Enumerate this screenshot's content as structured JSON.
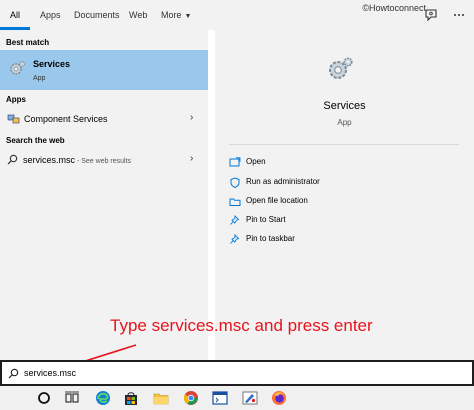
{
  "tabs": [
    {
      "label": "All",
      "active": true
    },
    {
      "label": "Apps"
    },
    {
      "label": "Documents"
    },
    {
      "label": "Web"
    },
    {
      "label": "More"
    }
  ],
  "watermark": "©Howtoconnect",
  "sections": {
    "best_match": "Best match",
    "apps": "Apps",
    "search_web": "Search the web"
  },
  "best_match_item": {
    "title": "Services",
    "subtitle": "App"
  },
  "apps_item": {
    "title": "Component Services"
  },
  "web_item": {
    "title": "services.msc",
    "suffix": " - See web results"
  },
  "details": {
    "app_name": "Services",
    "app_type": "App",
    "actions": [
      {
        "label": "Open",
        "icon": "open-window-icon"
      },
      {
        "label": "Run as administrator",
        "icon": "shield-icon"
      },
      {
        "label": "Open file location",
        "icon": "folder-icon"
      },
      {
        "label": "Pin to Start",
        "icon": "pin-icon"
      },
      {
        "label": "Pin to taskbar",
        "icon": "pin-icon"
      }
    ]
  },
  "annotation": "Type services.msc and press enter",
  "search": {
    "value": "services.msc"
  },
  "colors": {
    "accent": "#0078d7",
    "selection": "#99c8ec",
    "annotation": "#e8141d"
  },
  "taskbar_icons": [
    "cortana-icon",
    "task-view-icon",
    "edge-icon",
    "store-icon",
    "file-explorer-icon",
    "chrome-icon",
    "terminal-icon",
    "firefox-icon",
    "paint-icon"
  ]
}
